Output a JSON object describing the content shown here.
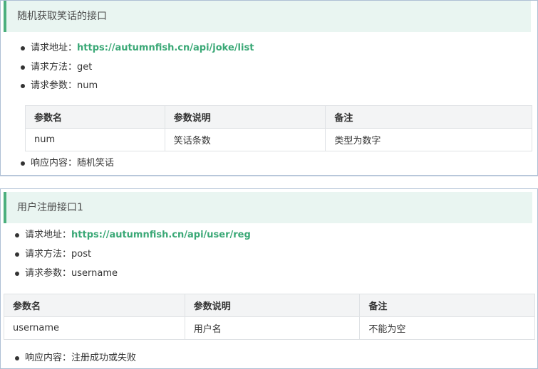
{
  "joke": {
    "title": "随机获取笑话的接口",
    "url_label": "请求地址：",
    "url": "https://autumnfish.cn/api/joke/list",
    "method_label": "请求方法：",
    "method": "get",
    "params_label": "请求参数：",
    "params": "num",
    "table": {
      "headers": [
        "参数名",
        "参数说明",
        "备注"
      ],
      "rows": [
        [
          "num",
          "笑话条数",
          "类型为数字"
        ]
      ]
    },
    "response_label": "响应内容：",
    "response": "随机笑话"
  },
  "reg": {
    "title": "用户注册接口1",
    "url_label": "请求地址：",
    "url": "https://autumnfish.cn/api/user/reg",
    "method_label": "请求方法：",
    "method": "post",
    "params_label": "请求参数：",
    "params": "username",
    "table": {
      "headers": [
        "参数名",
        "参数说明",
        "备注"
      ],
      "rows": [
        [
          "username",
          "用户名",
          "不能为空"
        ]
      ]
    },
    "response_label": "响应内容：",
    "response": "注册成功或失败"
  },
  "colors": {
    "link": "#3aa876",
    "accent_bar": "#4caf7d",
    "title_bg": "#e9f5f1",
    "table_header_bg": "#f3f4f5"
  }
}
